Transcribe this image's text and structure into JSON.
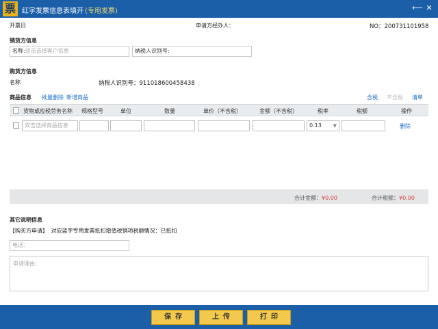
{
  "titlebar": {
    "icon_glyph": "票",
    "title": "红字发票信息表填开",
    "subtitle": "(专用发票)",
    "back_glyph": "⟵",
    "close_glyph": "✕"
  },
  "header": {
    "invoice_date_label": "开票日",
    "applicant_label": "申请方经办人：",
    "no_label": "NO：",
    "no_value": "200731101958"
  },
  "seller": {
    "section_title": "销货方信息",
    "name_label": "名称:",
    "name_placeholder": "双击选择客户信息",
    "tax_id_label": "纳税人识别号:"
  },
  "buyer": {
    "section_title": "购货方信息",
    "name_label": "名称",
    "tax_id_label": "纳税人识别号：",
    "tax_id_value": "911018600458438"
  },
  "goods": {
    "section_title": "商品信息",
    "batch_delete": "批量删除",
    "add_item": "新增商品",
    "tax_included": "含税",
    "tax_excluded": "不含税",
    "clear": "清单",
    "columns": [
      "货物或应税劳务名称",
      "规格型号",
      "单位",
      "数量",
      "单价（不含税）",
      "金额（不含税）",
      "税率",
      "税额",
      "操作"
    ],
    "row": {
      "name_placeholder": "双击选择商品信息",
      "tax_rate": "0.13",
      "delete": "删除"
    },
    "total_amount_label": "合计金额：",
    "total_amount_value": "¥0.00",
    "total_tax_label": "合计税额：",
    "total_tax_value": "¥0.00"
  },
  "other": {
    "section_title": "其它说明信息",
    "buyer_apply": "【购买方申请】",
    "statement": "对应蓝字专用发票抵扣增值税销项税额情况：已抵扣",
    "phone_placeholder": "电话：",
    "reason_placeholder": "申请理由："
  },
  "footer": {
    "save": "保存",
    "upload": "上传",
    "print": "打印"
  },
  "colors": {
    "titlebar": "#1b5fa8",
    "button": "#f2c94c",
    "link": "#1b6fd0",
    "amount": "#e03a3a"
  }
}
